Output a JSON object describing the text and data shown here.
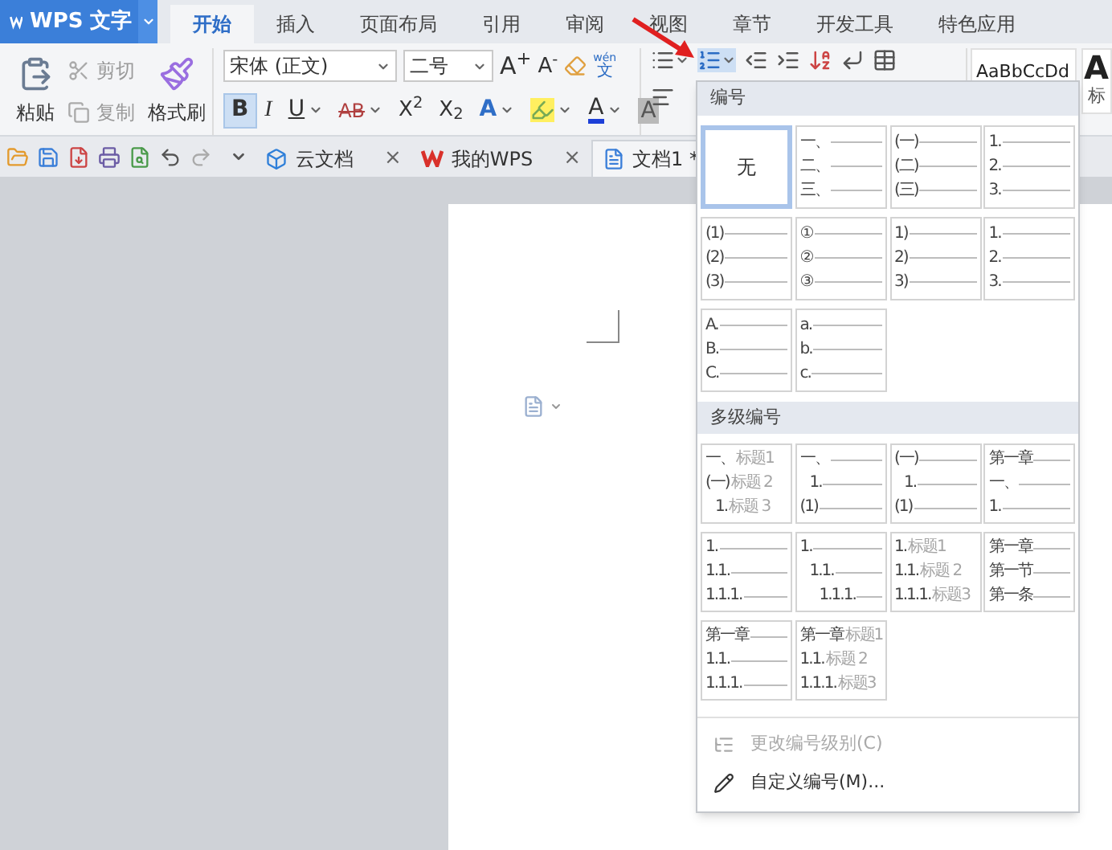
{
  "app_menu": {
    "label": "WPS 文字"
  },
  "ribbon_tabs": [
    {
      "label": "开始",
      "selected": true
    },
    {
      "label": "插入",
      "selected": false
    },
    {
      "label": "页面布局",
      "selected": false
    },
    {
      "label": "引用",
      "selected": false
    },
    {
      "label": "审阅",
      "selected": false
    },
    {
      "label": "视图",
      "selected": false
    },
    {
      "label": "章节",
      "selected": false
    },
    {
      "label": "开发工具",
      "selected": false
    },
    {
      "label": "特色应用",
      "selected": false
    }
  ],
  "clipboard": [
    {
      "kind": "paste",
      "label": "粘贴",
      "disabled": false
    },
    {
      "kind": "cut",
      "label": "剪切",
      "disabled": true
    },
    {
      "kind": "copy",
      "label": "复制",
      "disabled": true
    },
    {
      "kind": "painter",
      "label": "格式刷",
      "disabled": false
    }
  ],
  "font": {
    "family": "宋体 (正文)",
    "size": "二号",
    "grow": "A$^{+}$",
    "shrink": "A$^{-}$",
    "pinyin_top": "wén",
    "pinyin_bottom": "文"
  },
  "format_buttons": [
    {
      "kind": "bold",
      "label": "B",
      "on": true
    },
    {
      "kind": "italic",
      "label": "I",
      "on": false
    },
    {
      "kind": "underline",
      "label": "U",
      "on": false
    },
    {
      "kind": "strike",
      "label": "AB",
      "on": false
    },
    {
      "kind": "script",
      "label": "X$^{2}$",
      "on": false
    },
    {
      "kind": "script",
      "label": "X$_{2}$",
      "on": false
    },
    {
      "kind": "effect",
      "label": "A",
      "on": false
    },
    {
      "kind": "highlight",
      "on": false
    },
    {
      "kind": "color",
      "label": "A",
      "on": false
    },
    {
      "kind": "shade",
      "label": "A",
      "on": false
    }
  ],
  "styles": [
    {
      "preview": "AaBbCcDd"
    },
    {
      "preview": "A",
      "caption": "标"
    }
  ],
  "doc_tabs": [
    {
      "kind": "cloud",
      "label": "云文档",
      "close": "×",
      "selected": false
    },
    {
      "kind": "wps",
      "label": "我的WPS",
      "close": "×",
      "selected": false
    },
    {
      "kind": "doc",
      "label": "文档1 *",
      "selected": true
    }
  ],
  "numbering_menu": {
    "title": "编号",
    "presets": [
      {
        "kind": "none",
        "label": "无",
        "selected": true
      },
      {
        "kind": "list",
        "selected": false,
        "lines": [
          {
            "prefix": "一、"
          },
          {
            "prefix": "二、"
          },
          {
            "prefix": "三、"
          }
        ]
      },
      {
        "kind": "list",
        "selected": false,
        "lines": [
          {
            "prefix": "(一)"
          },
          {
            "prefix": "(二)"
          },
          {
            "prefix": "(三)"
          }
        ]
      },
      {
        "kind": "list",
        "selected": false,
        "lines": [
          {
            "prefix": "1."
          },
          {
            "prefix": "2."
          },
          {
            "prefix": "3."
          }
        ]
      },
      {
        "kind": "list",
        "selected": false,
        "lines": [
          {
            "prefix": "(1)"
          },
          {
            "prefix": "(2)"
          },
          {
            "prefix": "(3)"
          }
        ]
      },
      {
        "kind": "list",
        "selected": false,
        "lines": [
          {
            "prefix": "①"
          },
          {
            "prefix": "②"
          },
          {
            "prefix": "③"
          }
        ]
      },
      {
        "kind": "list",
        "selected": false,
        "lines": [
          {
            "prefix": "1)"
          },
          {
            "prefix": "2)"
          },
          {
            "prefix": "3)"
          }
        ]
      },
      {
        "kind": "list",
        "selected": false,
        "lines": [
          {
            "prefix": "1."
          },
          {
            "prefix": "2."
          },
          {
            "prefix": "3."
          }
        ]
      },
      {
        "kind": "list",
        "selected": false,
        "lines": [
          {
            "prefix": "A."
          },
          {
            "prefix": "B."
          },
          {
            "prefix": "C."
          }
        ]
      },
      {
        "kind": "list",
        "selected": false,
        "lines": [
          {
            "prefix": "a."
          },
          {
            "prefix": "b."
          },
          {
            "prefix": "c."
          }
        ]
      }
    ],
    "multilevel_title": "多级编号",
    "multilevel_presets": [
      {
        "kind": "list",
        "selected": false,
        "lines": [
          {
            "prefix": "一、",
            "heading": "标题1"
          },
          {
            "prefix": "(一)",
            "heading": "标题 2",
            "children": [
              {
                "prefix": "1.",
                "heading": "标题 3"
              }
            ]
          }
        ]
      },
      {
        "kind": "list",
        "selected": false,
        "lines": [
          {
            "prefix": "一、",
            "children": [
              {
                "prefix": "1."
              }
            ]
          },
          {
            "prefix": "(1)"
          }
        ]
      },
      {
        "kind": "list",
        "selected": false,
        "lines": [
          {
            "prefix": "(一)",
            "children": [
              {
                "prefix": "1."
              }
            ]
          },
          {
            "prefix": "(1)"
          }
        ]
      },
      {
        "kind": "list",
        "selected": false,
        "lines": [
          {
            "prefix": "第一章"
          },
          {
            "prefix": "一、"
          },
          {
            "prefix": "1."
          }
        ]
      },
      {
        "kind": "list",
        "selected": false,
        "lines": [
          {
            "prefix": "1."
          },
          {
            "prefix": "1.1."
          },
          {
            "prefix": "1.1.1."
          }
        ]
      },
      {
        "kind": "list",
        "selected": false,
        "lines": [
          {
            "prefix": "1.",
            "children": [
              {
                "prefix": "1.1.",
                "children": [
                  {
                    "prefix": "1.1.1."
                  }
                ]
              }
            ]
          }
        ]
      },
      {
        "kind": "list",
        "selected": false,
        "lines": [
          {
            "prefix": "1.",
            "heading": "标题1"
          },
          {
            "prefix": "1.1.",
            "heading": "标题 2"
          },
          {
            "prefix": "1.1.1.",
            "heading": "标题3"
          }
        ]
      },
      {
        "kind": "list",
        "selected": false,
        "lines": [
          {
            "prefix": "第一章"
          },
          {
            "prefix": "第一节"
          },
          {
            "prefix": "第一条"
          }
        ]
      },
      {
        "kind": "list",
        "selected": false,
        "lines": [
          {
            "prefix": "第一章"
          },
          {
            "prefix": "1.1."
          },
          {
            "prefix": "1.1.1."
          }
        ]
      },
      {
        "kind": "list",
        "selected": false,
        "lines": [
          {
            "prefix": "第一章",
            "heading": "标题1"
          },
          {
            "prefix": "1.1.",
            "heading": "标题 2"
          },
          {
            "prefix": "1.1.1.",
            "heading": "标题3"
          }
        ]
      }
    ],
    "actions": [
      {
        "kind": "level",
        "label": "更改编号级别(C)",
        "disabled": true
      },
      {
        "kind": "custom",
        "label": "自定义编号(M)...",
        "disabled": false
      }
    ]
  }
}
